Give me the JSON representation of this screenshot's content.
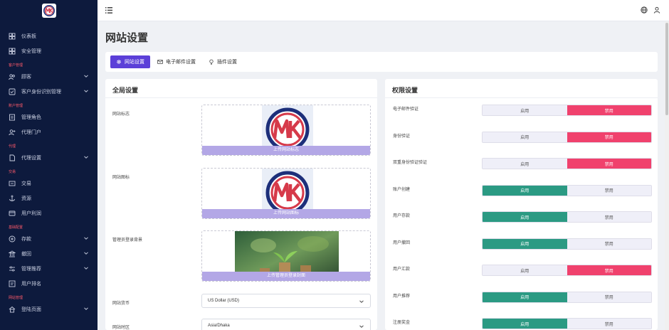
{
  "sidebar": {
    "items": [
      {
        "kind": "item",
        "label": "仪表板",
        "icon": "dashboard-icon"
      },
      {
        "kind": "item",
        "label": "安全管理",
        "icon": "grid-icon"
      },
      {
        "kind": "section",
        "label": "客户管理"
      },
      {
        "kind": "item",
        "label": "顾客",
        "icon": "users-icon",
        "chevron": true
      },
      {
        "kind": "item",
        "label": "客户身份识别管理",
        "icon": "id-check-icon",
        "chevron": true
      },
      {
        "kind": "section",
        "label": "账户管理"
      },
      {
        "kind": "item",
        "label": "管理角色",
        "icon": "document-icon"
      },
      {
        "kind": "item",
        "label": "代理门户",
        "icon": "user-add-icon"
      },
      {
        "kind": "section",
        "label": "代理"
      },
      {
        "kind": "item",
        "label": "代理设置",
        "icon": "file-icon",
        "chevron": true
      },
      {
        "kind": "section",
        "label": "交易"
      },
      {
        "kind": "item",
        "label": "交易",
        "icon": "transfer-icon"
      },
      {
        "kind": "item",
        "label": "资源",
        "icon": "anchor-icon"
      },
      {
        "kind": "item",
        "label": "用户利润",
        "icon": "card-icon"
      },
      {
        "kind": "section",
        "label": "基础配置"
      },
      {
        "kind": "item",
        "label": "存款",
        "icon": "plus-circle-icon",
        "chevron": true
      },
      {
        "kind": "item",
        "label": "撤回",
        "icon": "bank-icon",
        "chevron": true
      },
      {
        "kind": "item",
        "label": "管理推荐",
        "icon": "sliders-icon",
        "chevron": true
      },
      {
        "kind": "item",
        "label": "用户排名",
        "icon": "rank-icon"
      },
      {
        "kind": "section",
        "label": "网站管理"
      },
      {
        "kind": "item",
        "label": "登陆页面",
        "icon": "home-icon",
        "chevron": true
      }
    ]
  },
  "page": {
    "title": "网站设置"
  },
  "tabs": [
    {
      "label": "网站设置",
      "icon": "gear-icon",
      "active": true
    },
    {
      "label": "电子邮件设置",
      "icon": "mail-icon",
      "active": false
    },
    {
      "label": "插件设置",
      "icon": "bulb-icon",
      "active": false
    }
  ],
  "global": {
    "title": "全局设置",
    "logo_label": "网站标志",
    "logo_upload": "上传网站标志",
    "favicon_label": "网站图标",
    "favicon_upload": "上传网站图标",
    "bg_label": "管理员登录背景",
    "bg_upload": "上传管理员登录封面",
    "currency_label": "网站货币",
    "currency_value": "US Dollar (USD)",
    "timezone_label": "网站时区",
    "timezone_value": "Asia/Dhaka"
  },
  "permissions": {
    "title": "权限设置",
    "rows": [
      {
        "label": "电子邮件验证",
        "on": "启用",
        "off": "禁用",
        "state": "off"
      },
      {
        "label": "身份验证",
        "on": "启用",
        "off": "禁用",
        "state": "off"
      },
      {
        "label": "双重身份验证验证",
        "on": "启用",
        "off": "禁用",
        "state": "off"
      },
      {
        "label": "账户创建",
        "on": "启用",
        "off": "禁用",
        "state": "on"
      },
      {
        "label": "用户存款",
        "on": "启用",
        "off": "禁用",
        "state": "on"
      },
      {
        "label": "用户撤回",
        "on": "启用",
        "off": "禁用",
        "state": "on"
      },
      {
        "label": "用户汇款",
        "on": "启用",
        "off": "禁用",
        "state": "off"
      },
      {
        "label": "用户推荐",
        "on": "启用",
        "off": "禁用",
        "state": "on"
      },
      {
        "label": "注册奖金",
        "on": "启用",
        "off": "禁用",
        "state": "on"
      }
    ]
  },
  "colors": {
    "accent": "#5b3fd8",
    "sidebar": "#0d1a3d",
    "enabled": "#2b9a83",
    "disabled": "#f0416d"
  }
}
